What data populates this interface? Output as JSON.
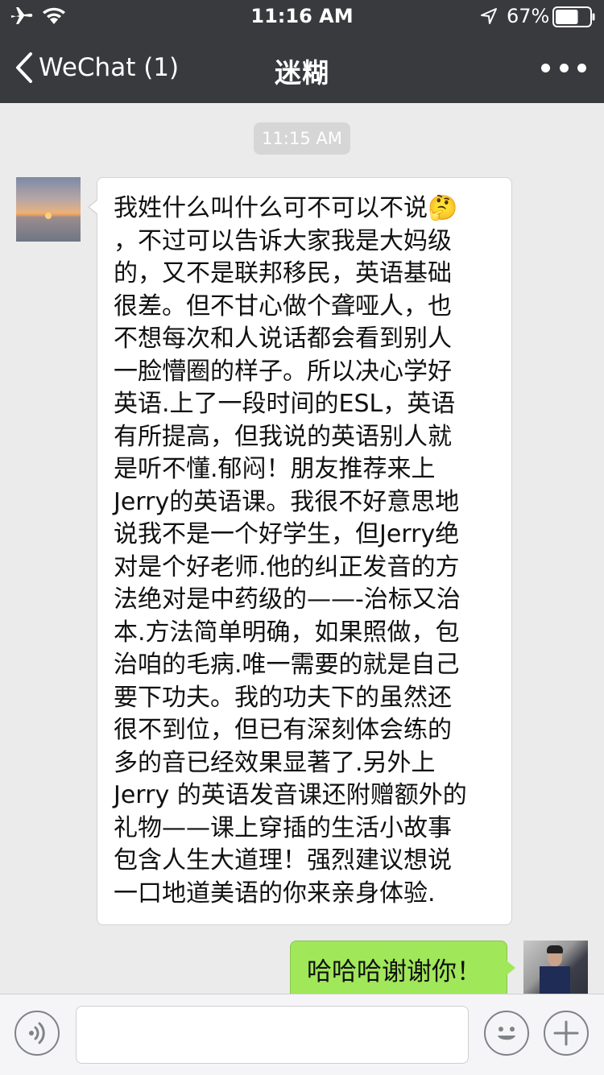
{
  "status_bar": {
    "time": "11:16 AM",
    "battery_percent": "67%",
    "battery_level": 0.67,
    "icons": [
      "airplane-icon",
      "wifi-icon",
      "location-arrow-icon",
      "battery-icon"
    ]
  },
  "nav": {
    "back_label": "WeChat (1)",
    "title": "迷糊",
    "more_icon": "more-dots-icon"
  },
  "chat": {
    "timestamp": "11:15 AM",
    "messages": [
      {
        "side": "left",
        "lines": [
          "我姓什么叫什么可不可以不说🤔",
          "，不过可以告诉大家我是大妈级",
          "的，又不是联邦移民，英语基础",
          "很差。但不甘心做个聋哑人，也",
          "不想每次和人说话都会看到别人",
          "一脸懵圈的样子。所以决心学好",
          "英语.上了一段时间的ESL，英语",
          "有所提高，但我说的英语别人就",
          "是听不懂.郁闷！朋友推荐来上",
          "Jerry的英语课。我很不好意思地",
          "说我不是一个好学生，但Jerry绝",
          "对是个好老师.他的纠正发音的方",
          "法绝对是中药级的——-治标又治",
          "本.方法简单明确，如果照做，包",
          "治咱的毛病.唯一需要的就是自己",
          "要下功夫。我的功夫下的虽然还",
          "很不到位，但已有深刻体会练的",
          "多的音已经效果显著了.另外上",
          "Jerry 的英语发音课还附赠额外的",
          "礼物——课上穿插的生活小故事",
          "包含人生大道理！强烈建议想说",
          "一口地道美语的你来亲身体验."
        ]
      },
      {
        "side": "right",
        "text": "哈哈哈谢谢你！"
      }
    ]
  },
  "input_bar": {
    "voice_icon": "voice-icon",
    "emoji_icon": "emoji-icon",
    "plus_icon": "plus-icon",
    "placeholder": ""
  },
  "colors": {
    "header_bg": "#393a3e",
    "chat_bg": "#ebebeb",
    "sent_bubble": "#a0e75a",
    "received_bubble": "#ffffff"
  }
}
